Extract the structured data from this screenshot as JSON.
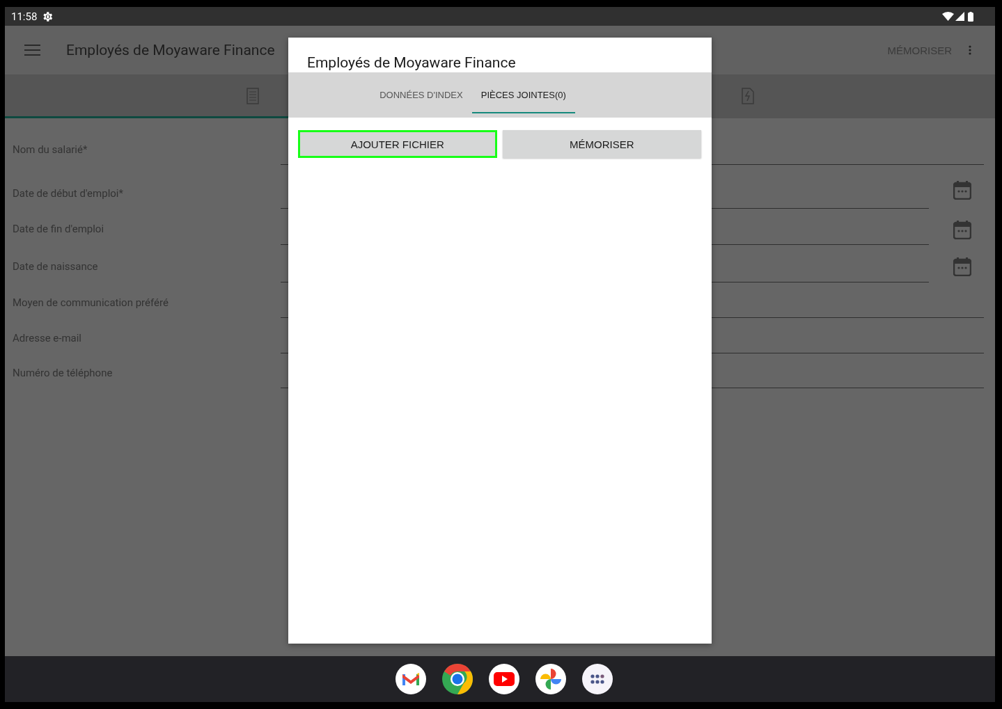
{
  "status_bar": {
    "time": "11:58"
  },
  "app_bar": {
    "title": "Employés de Moyaware Finance",
    "action": "MÉMORISER"
  },
  "form_tabs": [
    {
      "selected": true
    },
    {
      "selected": false
    }
  ],
  "form": {
    "fields": [
      {
        "label": "Nom du salarié*",
        "kind": "text"
      },
      {
        "label": "Date de début d'emploi*",
        "kind": "date"
      },
      {
        "label": "Date de fin d'emploi",
        "kind": "date"
      },
      {
        "label": "Date de naissance",
        "kind": "date"
      },
      {
        "label": "Moyen de communication préféré",
        "kind": "text"
      },
      {
        "label": "Adresse e-mail",
        "kind": "text"
      },
      {
        "label": "Numéro de téléphone",
        "kind": "text"
      }
    ]
  },
  "dialog": {
    "title": "Employés de Moyaware Finance",
    "tabs": [
      {
        "label": "DONNÉES D'INDEX",
        "selected": false
      },
      {
        "label": "PIÈCES JOINTES(0)",
        "selected": true
      }
    ],
    "buttons": [
      {
        "label": "AJOUTER FICHIER",
        "focused": true
      },
      {
        "label": "MÉMORISER",
        "focused": false
      }
    ]
  }
}
